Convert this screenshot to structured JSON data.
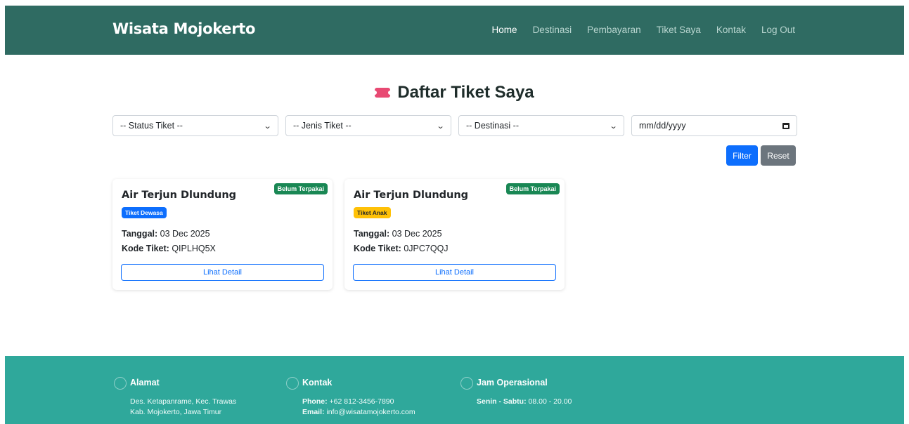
{
  "navbar": {
    "brand": "Wisata Mojokerto",
    "links": [
      "Home",
      "Destinasi",
      "Pembayaran",
      "Tiket Saya",
      "Kontak",
      "Log Out"
    ],
    "active": "Home"
  },
  "page": {
    "title": "Daftar Tiket Saya"
  },
  "filters": {
    "status": "-- Status Tiket --",
    "jenis": "-- Jenis Tiket --",
    "destinasi": "-- Destinasi --",
    "date_placeholder": "mm/dd/yyyy",
    "filter_label": "Filter",
    "reset_label": "Reset"
  },
  "tickets": [
    {
      "destination": "Air Terjun Dlundung",
      "status": "Belum Terpakai",
      "type": "Tiket Dewasa",
      "date_label": "Tanggal:",
      "date": "03 Dec 2025",
      "code_label": "Kode Tiket:",
      "code": "QIPLHQ5X",
      "detail_label": "Lihat Detail"
    },
    {
      "destination": "Air Terjun Dlundung",
      "status": "Belum Terpakai",
      "type": "Tiket Anak",
      "date_label": "Tanggal:",
      "date": "03 Dec 2025",
      "code_label": "Kode Tiket:",
      "code": "0JPC7QQJ",
      "detail_label": "Lihat Detail"
    }
  ],
  "footer": {
    "alamat": {
      "title": "Alamat",
      "line1": "Des. Ketapanrame, Kec. Trawas",
      "line2": "Kab. Mojokerto, Jawa Timur"
    },
    "kontak": {
      "title": "Kontak",
      "phone_label": "Phone:",
      "phone": "+62 812-3456-7890",
      "email_label": "Email:",
      "email": "info@wisatamojokerto.com"
    },
    "jam": {
      "title": "Jam Operasional",
      "days_label": "Senin - Sabtu:",
      "hours": "08.00 - 20.00"
    }
  },
  "colors": {
    "navbar": "#2f6b62",
    "footer": "#2fa89b",
    "primary": "#0d6efd",
    "success": "#198754",
    "warning": "#ffc107",
    "secondary": "#6c757d"
  }
}
